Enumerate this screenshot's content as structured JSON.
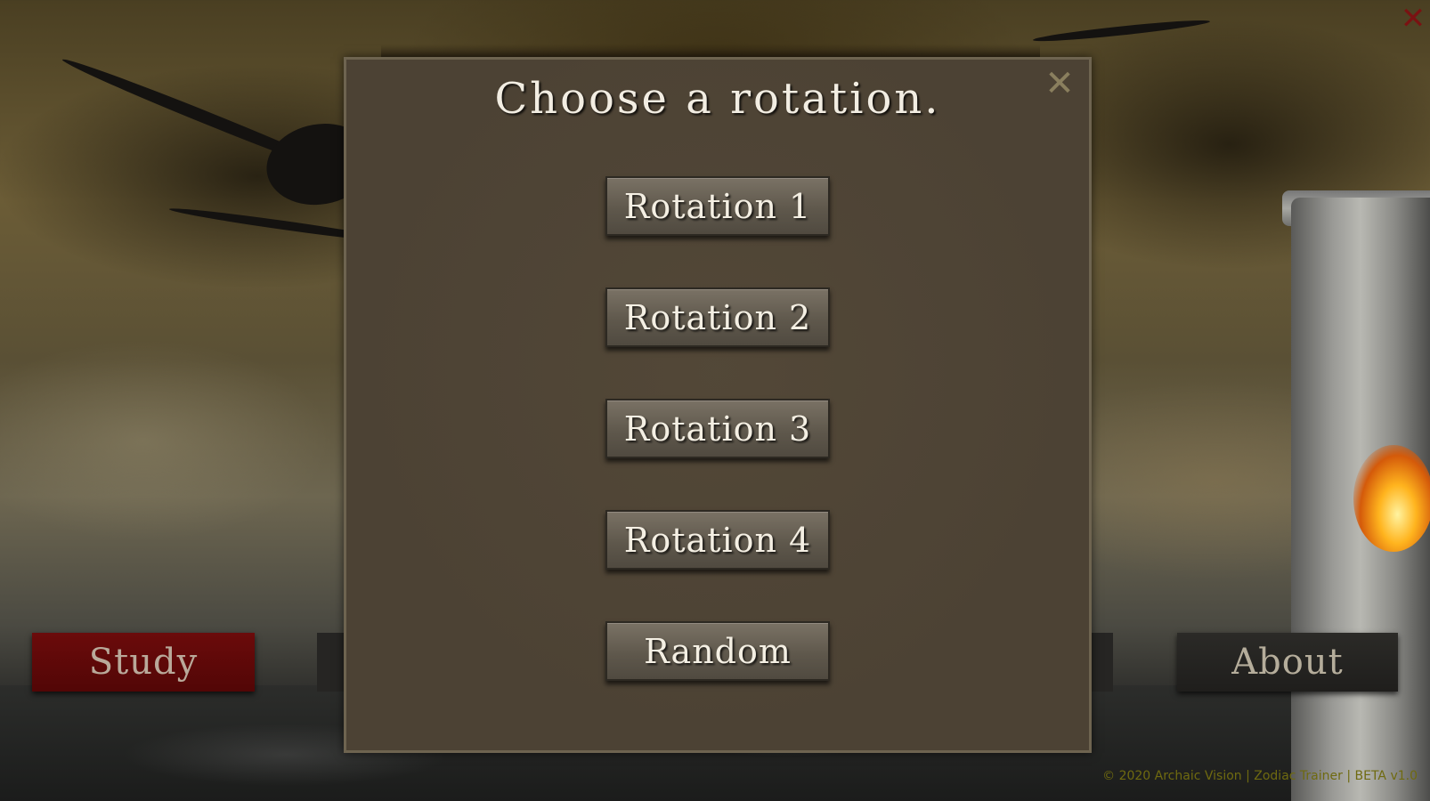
{
  "dialog": {
    "title": "Choose a rotation.",
    "close_label": "✕",
    "options": [
      {
        "label": "Rotation 1"
      },
      {
        "label": "Rotation 2"
      },
      {
        "label": "Rotation 3"
      },
      {
        "label": "Rotation 4"
      },
      {
        "label": "Random"
      }
    ]
  },
  "menu": {
    "study_label": "Study",
    "about_label": "About"
  },
  "window": {
    "close_label": "✕"
  },
  "footer": {
    "text": "© 2020 Archaic Vision | Zodiac Trainer | BETA v1.0"
  },
  "colors": {
    "dialog_bg": "#4c4234",
    "button_bg": "#6a6356",
    "study_bg": "#600808",
    "about_bg": "#262523",
    "footer_text": "#6f6a10",
    "corner_close": "#7a1212"
  }
}
